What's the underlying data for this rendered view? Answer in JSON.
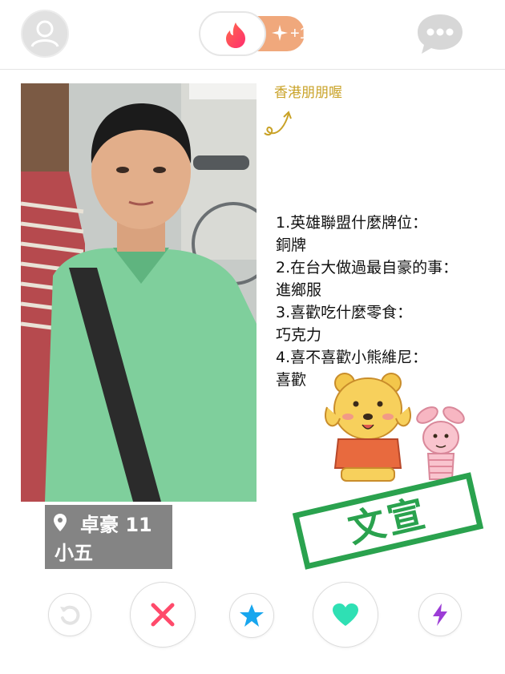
{
  "header": {
    "profile_icon": "user-silhouette-icon",
    "logo_icon": "flame-icon",
    "boost_count": "+1",
    "boost_icon": "sparkle-icon",
    "messages_icon": "chat-bubble-icon",
    "accent": "#ff5864",
    "boost_color": "#f0a87c"
  },
  "card": {
    "caption": "香港朋朋喔",
    "qa": [
      "1.英雄聯盟什麼牌位：",
      "銅牌",
      "2.在台大做過最自豪的事：",
      "進鄉服",
      "3.喜歡吃什麼零食：",
      "巧克力",
      "4.喜不喜歡小熊維尼：",
      "喜歡"
    ],
    "stamp_text": "文宣",
    "stamp_color": "#2aa24e",
    "name": "卓豪",
    "age": "11",
    "subtitle": "小五"
  },
  "actions": [
    {
      "name": "rewind",
      "icon": "rewind-icon",
      "color": "#e9e9e9"
    },
    {
      "name": "nope",
      "icon": "x-icon",
      "color": "#ff4a6b"
    },
    {
      "name": "super-like",
      "icon": "star-icon",
      "color": "#18a6ee"
    },
    {
      "name": "like",
      "icon": "heart-icon",
      "color": "#2fe0b4"
    },
    {
      "name": "boost",
      "icon": "lightning-icon",
      "color": "#9c3cd6"
    }
  ]
}
